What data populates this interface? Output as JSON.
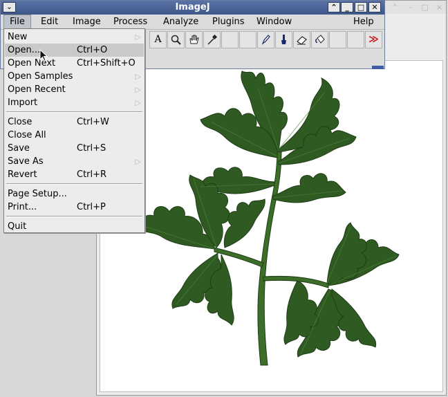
{
  "window": {
    "title": "ImageJ",
    "buttons": [
      "chevron-up",
      "minimize",
      "maximize",
      "close"
    ]
  },
  "menubar": [
    "File",
    "Edit",
    "Image",
    "Process",
    "Analyze",
    "Plugins",
    "Window",
    "Help"
  ],
  "toolbar": {
    "tools": [
      "text-icon",
      "magnifier-icon",
      "hand-icon",
      "color-picker-icon",
      "pencil-icon",
      "brush-icon",
      "eraser-icon",
      "flood-fill-icon",
      "more-tools-icon"
    ],
    "text_tool_glyph": "A",
    "more_glyph": "≫"
  },
  "file_menu": {
    "items": [
      {
        "label": "New",
        "shortcut": "",
        "submenu": true
      },
      {
        "label": "Open...",
        "shortcut": "Ctrl+O",
        "submenu": false,
        "highlighted": true
      },
      {
        "label": "Open Next",
        "shortcut": "Ctrl+Shift+O",
        "submenu": false
      },
      {
        "label": "Open Samples",
        "shortcut": "",
        "submenu": true
      },
      {
        "label": "Open Recent",
        "shortcut": "",
        "submenu": true
      },
      {
        "label": "Import",
        "shortcut": "",
        "submenu": true
      },
      {
        "label": "Close",
        "shortcut": "Ctrl+W",
        "submenu": false
      },
      {
        "label": "Close All",
        "shortcut": "",
        "submenu": false
      },
      {
        "label": "Save",
        "shortcut": "Ctrl+S",
        "submenu": false
      },
      {
        "label": "Save As",
        "shortcut": "",
        "submenu": true
      },
      {
        "label": "Revert",
        "shortcut": "Ctrl+R",
        "submenu": false
      },
      {
        "label": "Page Setup...",
        "shortcut": "",
        "submenu": false
      },
      {
        "label": "Print...",
        "shortcut": "Ctrl+P",
        "submenu": false
      },
      {
        "label": "Quit",
        "shortcut": "",
        "submenu": false
      }
    ],
    "submenu_arrow": "▷"
  },
  "image_window": {
    "content": "parsley leaf on white background"
  },
  "colors": {
    "titlebar": "#4a6396",
    "highlight": "#c9c9c9",
    "leaf": "#2f5a22",
    "status_accent": "#3e5da6"
  }
}
